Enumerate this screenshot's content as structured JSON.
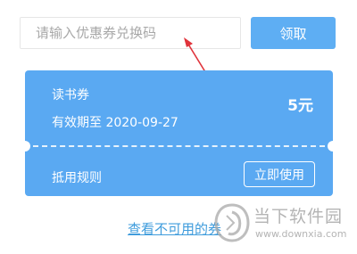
{
  "redeem": {
    "placeholder": "请输入优惠券兑换码",
    "value": "",
    "button_label": "领取"
  },
  "annotation": {
    "arrow_color": "#e0333b"
  },
  "coupon": {
    "name": "读书券",
    "expiry": "有效期至 2020-09-27",
    "amount": "5元",
    "rules_label": "抵用规则",
    "use_button_label": "立即使用",
    "background_color": "#5aa9f2"
  },
  "unavailable_link": "查看不可用的券",
  "watermark": {
    "name": "当下软件园",
    "url": "www.downxia.com"
  },
  "colors": {
    "accent": "#5eaef3",
    "link": "#3f9cdc"
  }
}
